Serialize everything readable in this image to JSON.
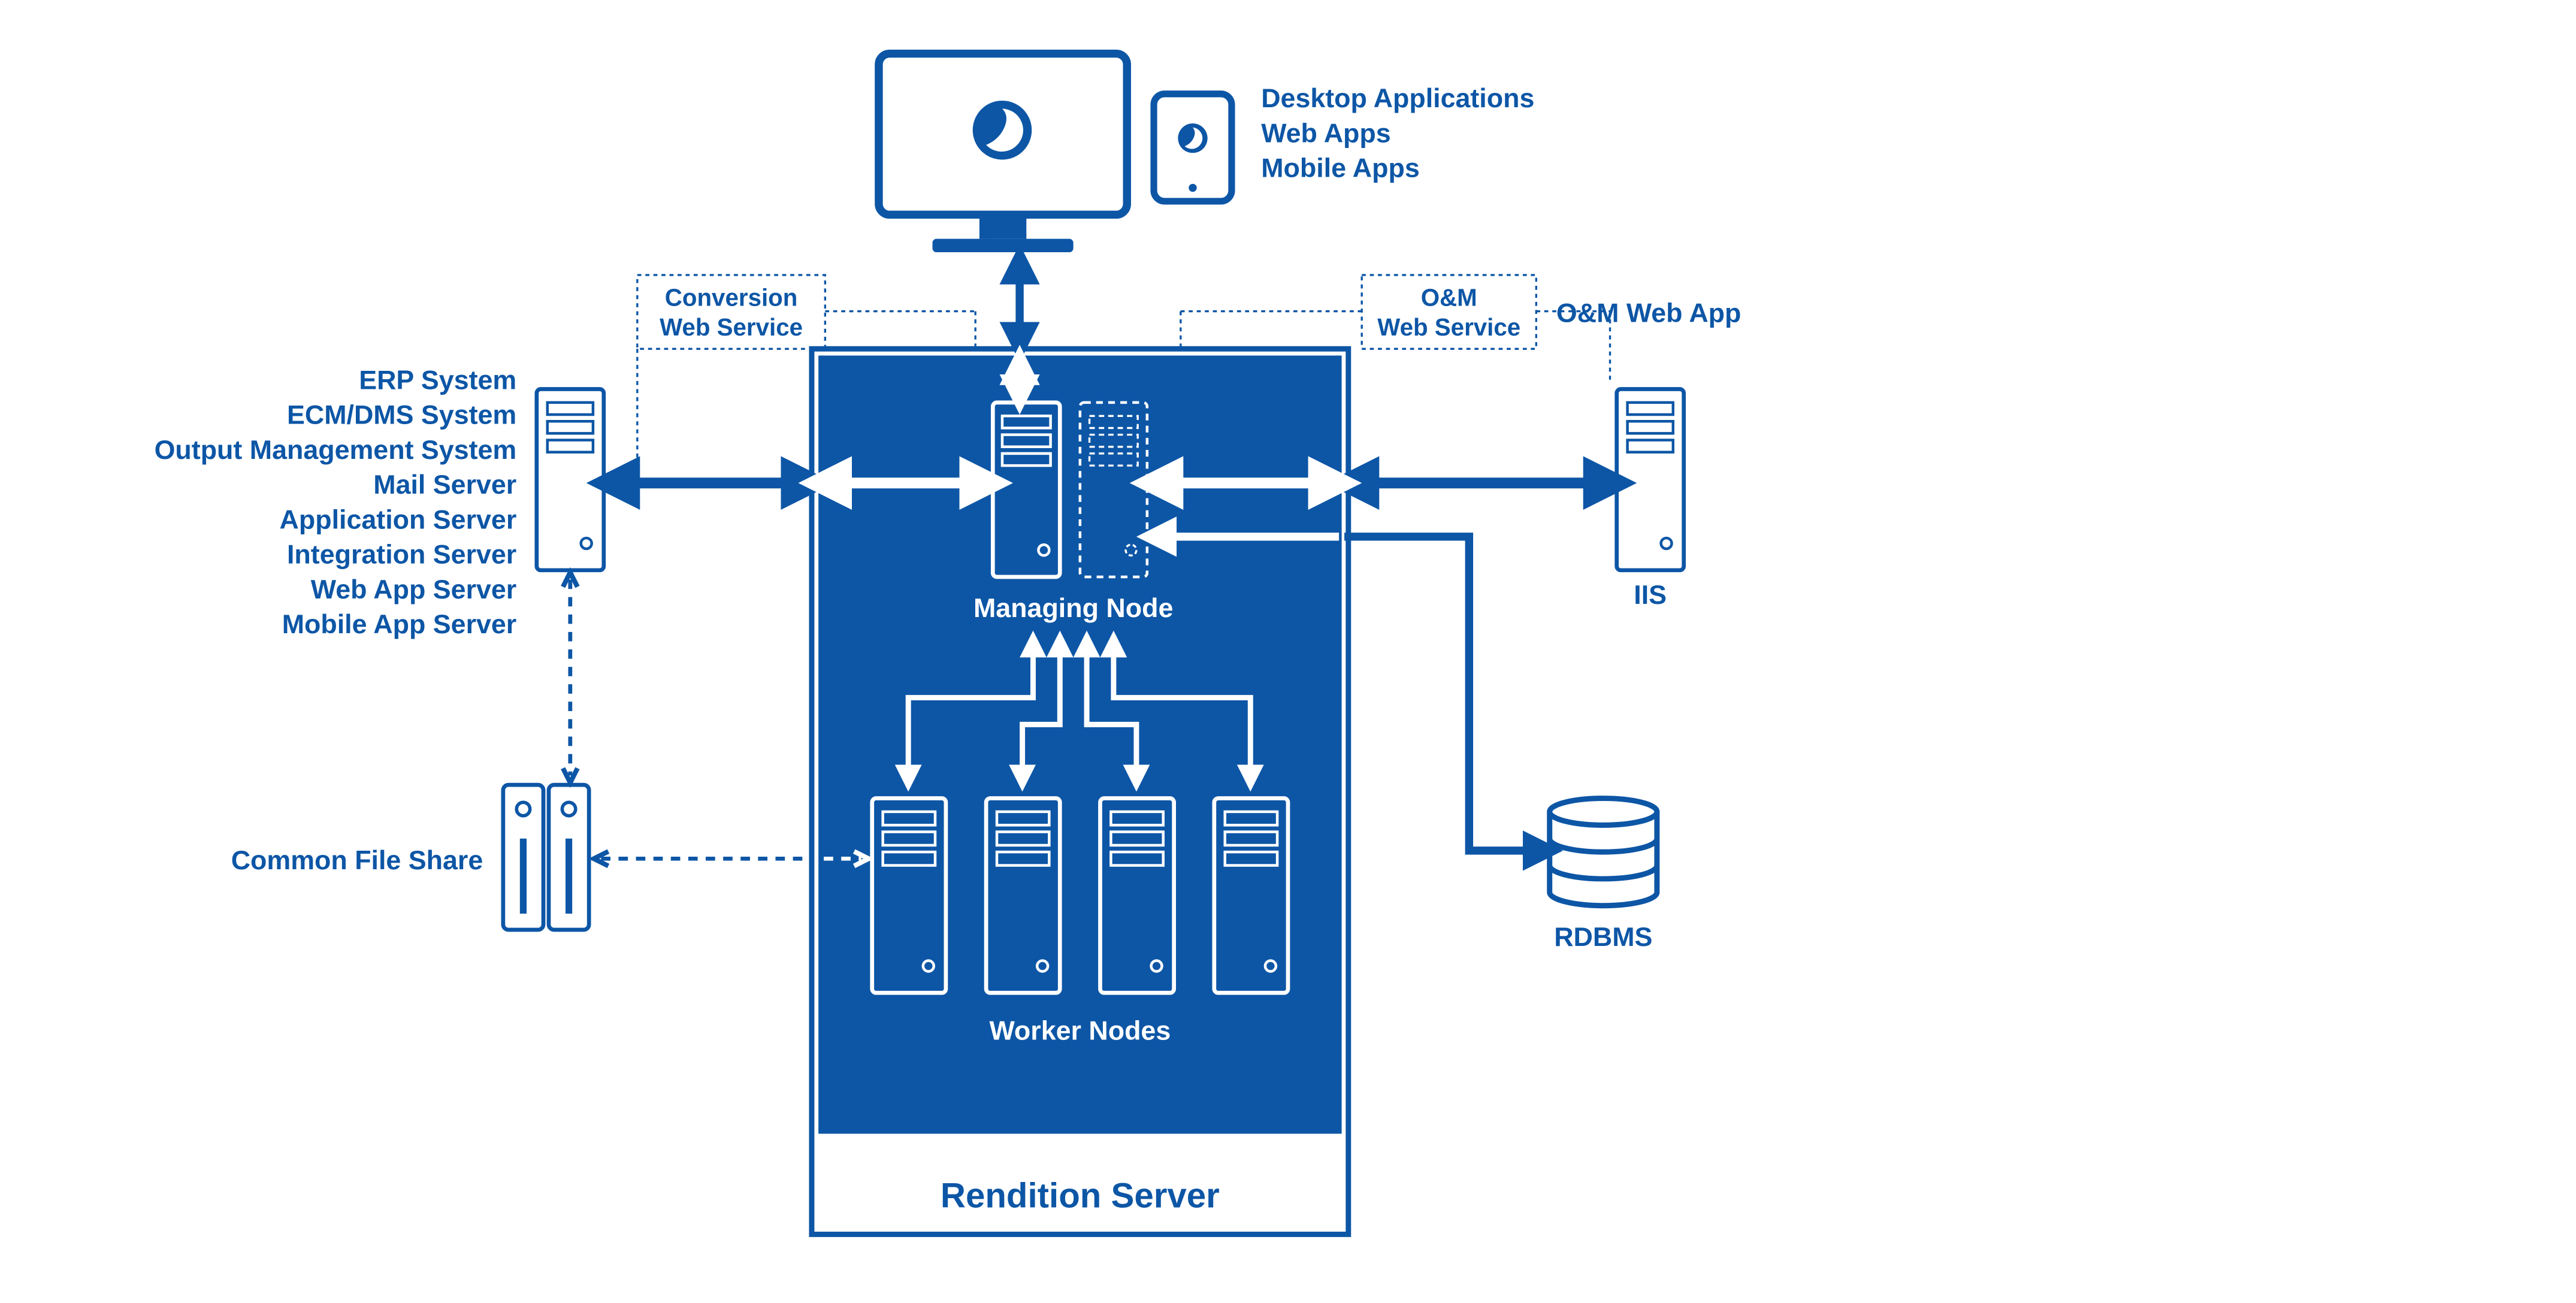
{
  "colors": {
    "primary": "#0d56a6",
    "white": "#ffffff",
    "background": "transparent"
  },
  "top": {
    "apps": [
      "Desktop Applications",
      "Web Apps",
      "Mobile Apps"
    ]
  },
  "left": {
    "systems": [
      "ERP System",
      "ECM/DMS System",
      "Output Management System",
      "Mail Server",
      "Application Server",
      "Integration Server",
      "Web App Server",
      "Mobile App Server"
    ],
    "fileShare": "Common File Share"
  },
  "services": {
    "conversion": "Conversion\nWeb Service",
    "oam": "O&M\nWeb Service"
  },
  "right": {
    "webAppLabel": "O&M Web App",
    "iisLabel": "IIS",
    "rdbmsLabel": "RDBMS"
  },
  "center": {
    "managingNode": "Managing Node",
    "workerNodes": "Worker Nodes",
    "title": "Rendition Server"
  }
}
